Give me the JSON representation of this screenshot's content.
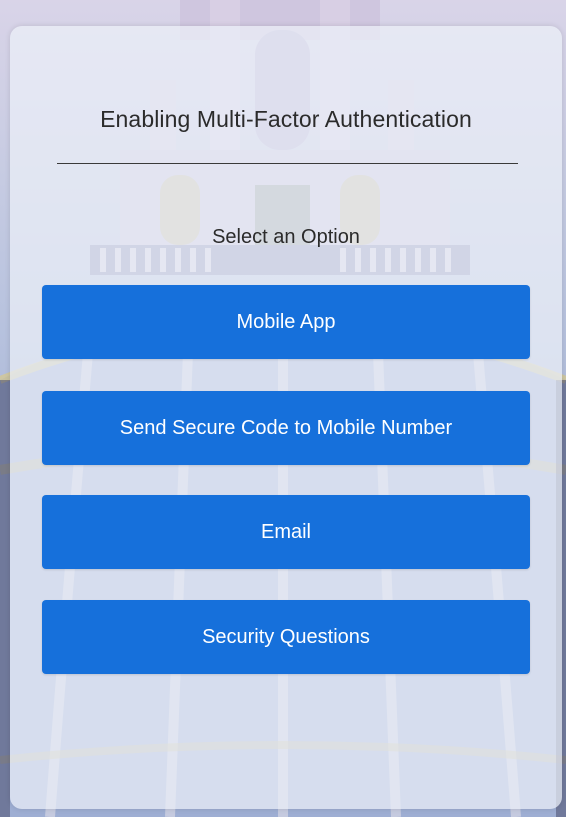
{
  "dialog": {
    "title": "Enabling Multi-Factor Authentication",
    "subtitle": "Select an Option"
  },
  "options": [
    {
      "label": "Mobile App"
    },
    {
      "label": "Send Secure Code to Mobile Number"
    },
    {
      "label": "Email"
    },
    {
      "label": "Security Questions"
    }
  ],
  "colors": {
    "button_bg": "#1670db",
    "button_text": "#ffffff",
    "text": "#2b2b2b"
  },
  "background": {
    "icon": "dome-illustration"
  }
}
